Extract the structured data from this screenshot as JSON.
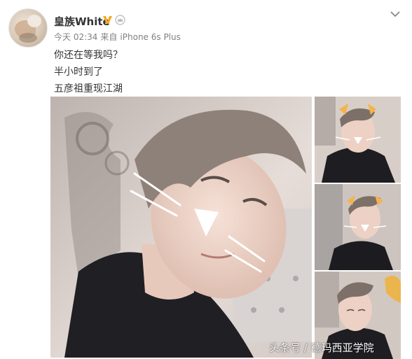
{
  "post": {
    "username": "皇族White",
    "time": "今天 02:34",
    "source_prefix": "来自",
    "source": "iPhone 6s Plus",
    "lines": [
      "你还在等我吗？",
      "半小时到了",
      "五彦祖重现江湖"
    ]
  },
  "icons": {
    "verified": "verified-badge-icon",
    "crown": "crown-icon",
    "menu": "chevron-down-icon"
  },
  "photos": {
    "count": 4,
    "watermark": "头条号 / 德玛西亚学院"
  },
  "colors": {
    "username": "#333333",
    "meta": "#808080",
    "verified": "#f7a81b"
  }
}
